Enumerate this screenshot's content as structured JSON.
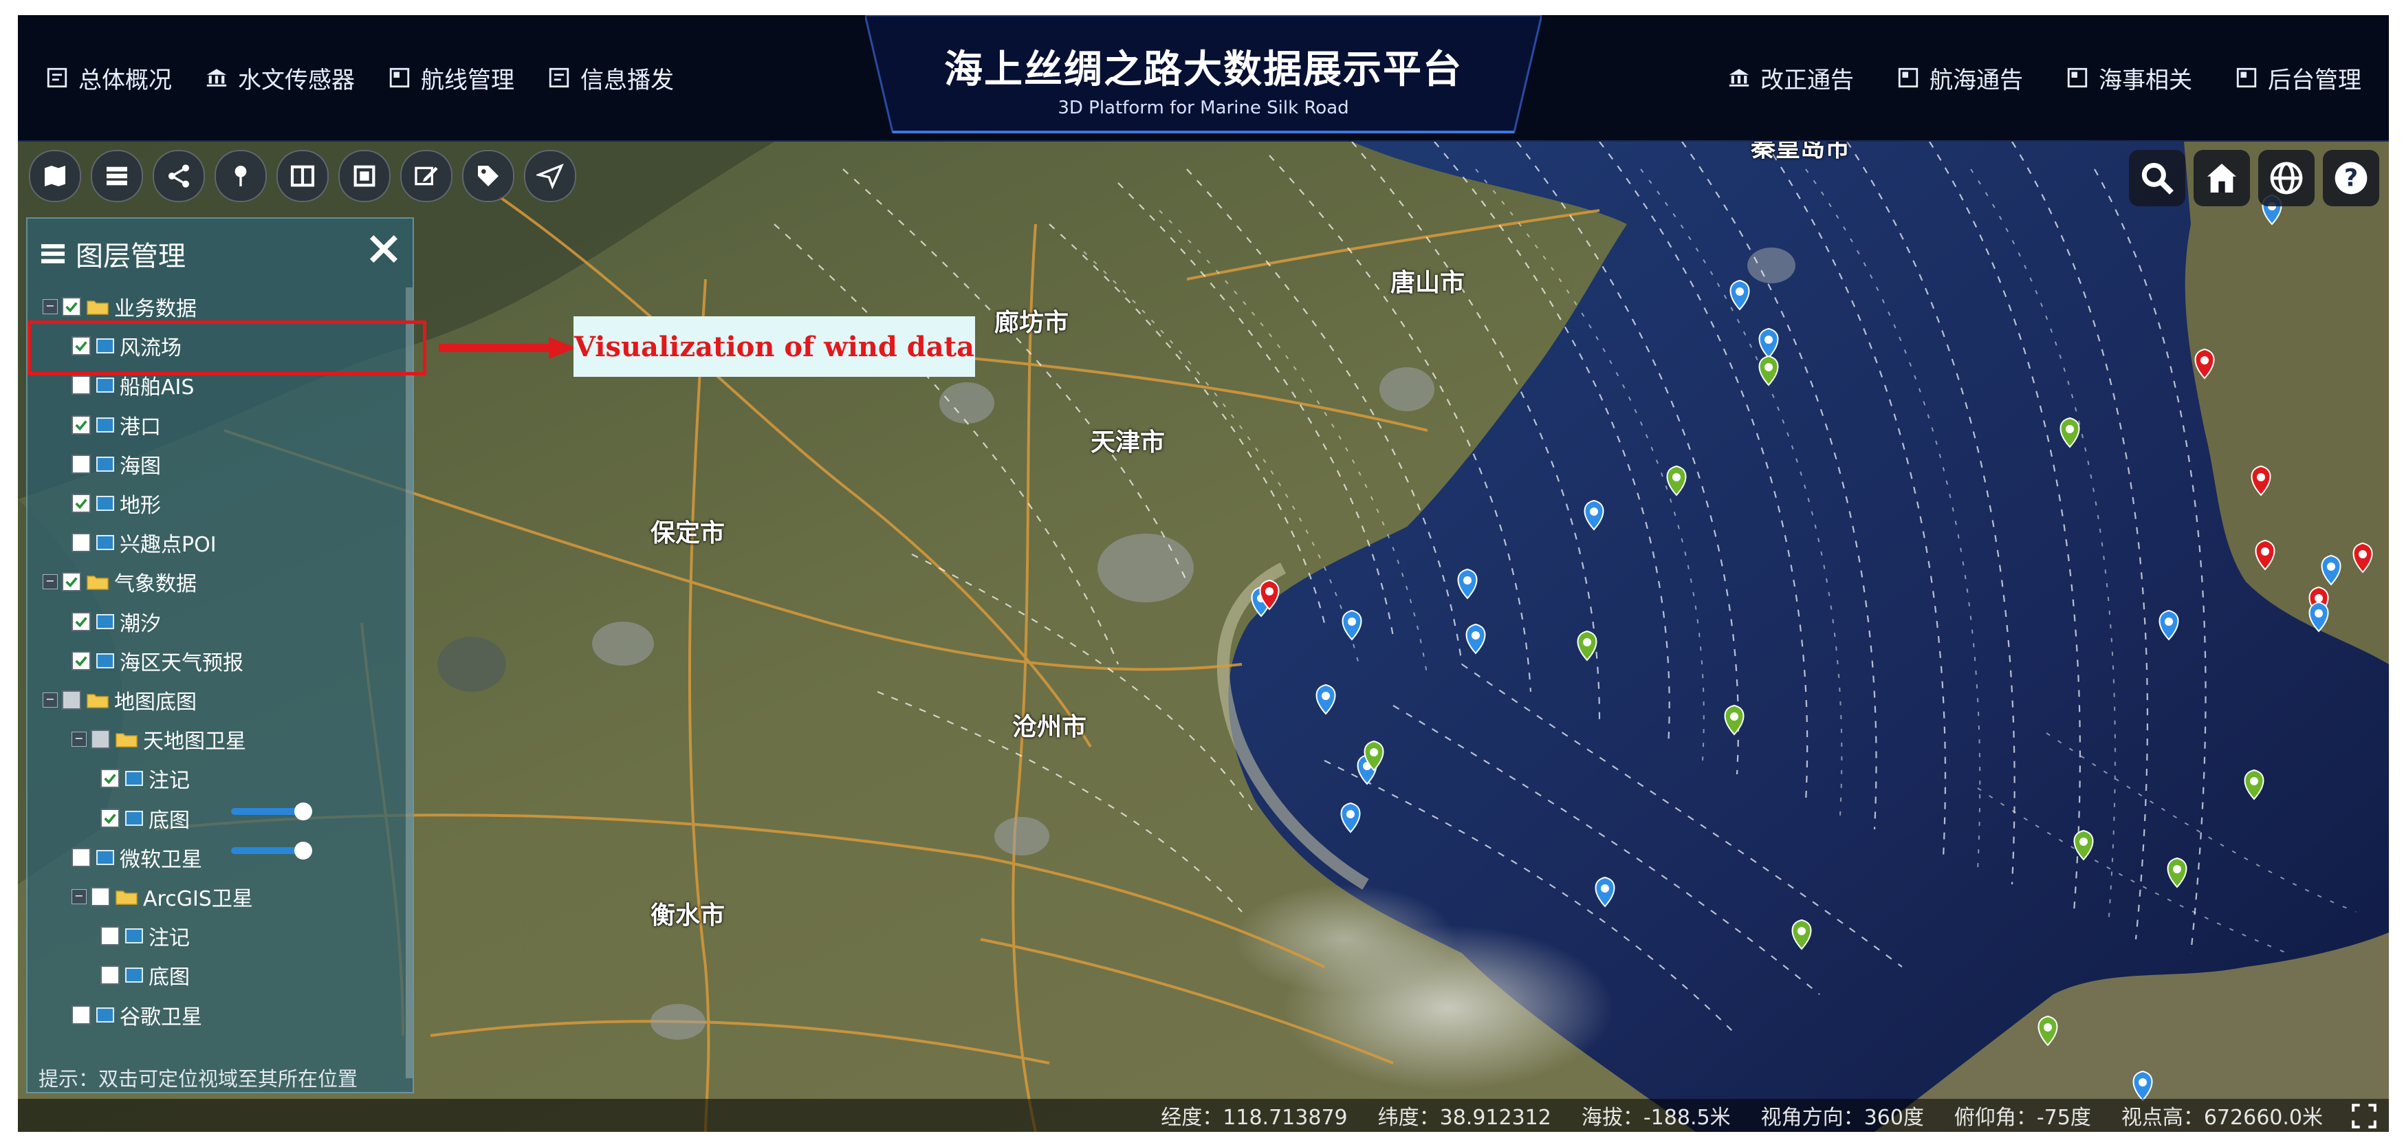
{
  "header": {
    "title": "海上丝绸之路大数据展示平台",
    "subtitle": "3D Platform for Marine Silk Road",
    "nav_left": [
      "总体概况",
      "水文传感器",
      "航线管理",
      "信息播发"
    ],
    "nav_right": [
      "改正通告",
      "航海通告",
      "海事相关",
      "后台管理"
    ]
  },
  "toolbar_left_icons": [
    "map-icon",
    "list-icon",
    "share-icon",
    "pin-icon",
    "split-view-icon",
    "frame-icon",
    "edit-icon",
    "tag-icon",
    "send-icon"
  ],
  "toolbar_right_icons": [
    "search-icon",
    "home-icon",
    "globe-icon",
    "help-icon"
  ],
  "layer_panel": {
    "title": "图层管理",
    "items": [
      {
        "label": "业务数据",
        "kind": "folder",
        "checked": true
      },
      {
        "label": "风流场",
        "kind": "layer",
        "checked": true
      },
      {
        "label": "船舶AIS",
        "kind": "layer",
        "checked": false
      },
      {
        "label": "港口",
        "kind": "layer",
        "checked": true
      },
      {
        "label": "海图",
        "kind": "layer",
        "checked": false
      },
      {
        "label": "地形",
        "kind": "layer",
        "checked": true
      },
      {
        "label": "兴趣点POI",
        "kind": "layer",
        "checked": false
      },
      {
        "label": "气象数据",
        "kind": "folder",
        "checked": true
      },
      {
        "label": "潮汐",
        "kind": "layer",
        "checked": true
      },
      {
        "label": "海区天气预报",
        "kind": "layer",
        "checked": true
      },
      {
        "label": "地图底图",
        "kind": "folder",
        "checked": false
      },
      {
        "label": "天地图卫星",
        "kind": "folder",
        "checked": false
      },
      {
        "label": "注记",
        "kind": "layer",
        "checked": true
      },
      {
        "label": "底图",
        "kind": "layer",
        "checked": true
      },
      {
        "label": "微软卫星",
        "kind": "layer",
        "checked": false
      },
      {
        "label": "ArcGIS卫星",
        "kind": "folder",
        "checked": false
      },
      {
        "label": "注记",
        "kind": "layer",
        "checked": false
      },
      {
        "label": "底图",
        "kind": "layer",
        "checked": false
      },
      {
        "label": "谷歌卫星",
        "kind": "layer",
        "checked": false
      }
    ],
    "hint": "提示：双击可定位视域至其所在位置"
  },
  "annotation": {
    "label": "Visualization of wind data"
  },
  "map_labels": {
    "cities": [
      "唐山市",
      "廊坊市",
      "天津市",
      "保定市",
      "沧州市",
      "衡水市",
      "秦皇岛市"
    ]
  },
  "statusbar": {
    "longitude": "经度：118.713879",
    "latitude": "纬度：38.912312",
    "altitude": "海拔：-188.5米",
    "heading": "视角方向：360度",
    "pitch": "俯仰角：-75度",
    "camera_height": "视点高：672660.0米"
  },
  "colors": {
    "header_bg": "#050a1a",
    "sea": "#1c2f63",
    "land": "#5e6b3e",
    "panel": "#2e6070",
    "annotation_red": "#e0191c",
    "marker_blue": "#2f8fe8",
    "marker_green": "#6cb52a",
    "marker_red": "#e0191c"
  }
}
